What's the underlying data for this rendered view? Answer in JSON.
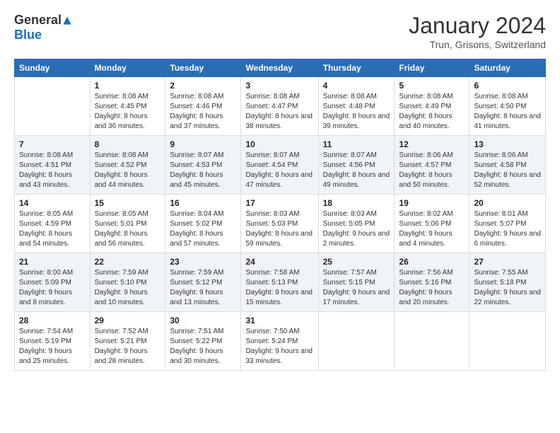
{
  "header": {
    "logo_general": "General",
    "logo_blue": "Blue",
    "month_title": "January 2024",
    "location": "Trun, Grisons, Switzerland"
  },
  "days_of_week": [
    "Sunday",
    "Monday",
    "Tuesday",
    "Wednesday",
    "Thursday",
    "Friday",
    "Saturday"
  ],
  "weeks": [
    [
      {
        "day": "",
        "sunrise": "",
        "sunset": "",
        "daylight": ""
      },
      {
        "day": "1",
        "sunrise": "Sunrise: 8:08 AM",
        "sunset": "Sunset: 4:45 PM",
        "daylight": "Daylight: 8 hours and 36 minutes."
      },
      {
        "day": "2",
        "sunrise": "Sunrise: 8:08 AM",
        "sunset": "Sunset: 4:46 PM",
        "daylight": "Daylight: 8 hours and 37 minutes."
      },
      {
        "day": "3",
        "sunrise": "Sunrise: 8:08 AM",
        "sunset": "Sunset: 4:47 PM",
        "daylight": "Daylight: 8 hours and 38 minutes."
      },
      {
        "day": "4",
        "sunrise": "Sunrise: 8:08 AM",
        "sunset": "Sunset: 4:48 PM",
        "daylight": "Daylight: 8 hours and 39 minutes."
      },
      {
        "day": "5",
        "sunrise": "Sunrise: 8:08 AM",
        "sunset": "Sunset: 4:49 PM",
        "daylight": "Daylight: 8 hours and 40 minutes."
      },
      {
        "day": "6",
        "sunrise": "Sunrise: 8:08 AM",
        "sunset": "Sunset: 4:50 PM",
        "daylight": "Daylight: 8 hours and 41 minutes."
      }
    ],
    [
      {
        "day": "7",
        "sunrise": "Sunrise: 8:08 AM",
        "sunset": "Sunset: 4:51 PM",
        "daylight": "Daylight: 8 hours and 43 minutes."
      },
      {
        "day": "8",
        "sunrise": "Sunrise: 8:08 AM",
        "sunset": "Sunset: 4:52 PM",
        "daylight": "Daylight: 8 hours and 44 minutes."
      },
      {
        "day": "9",
        "sunrise": "Sunrise: 8:07 AM",
        "sunset": "Sunset: 4:53 PM",
        "daylight": "Daylight: 8 hours and 45 minutes."
      },
      {
        "day": "10",
        "sunrise": "Sunrise: 8:07 AM",
        "sunset": "Sunset: 4:54 PM",
        "daylight": "Daylight: 8 hours and 47 minutes."
      },
      {
        "day": "11",
        "sunrise": "Sunrise: 8:07 AM",
        "sunset": "Sunset: 4:56 PM",
        "daylight": "Daylight: 8 hours and 49 minutes."
      },
      {
        "day": "12",
        "sunrise": "Sunrise: 8:06 AM",
        "sunset": "Sunset: 4:57 PM",
        "daylight": "Daylight: 8 hours and 50 minutes."
      },
      {
        "day": "13",
        "sunrise": "Sunrise: 8:06 AM",
        "sunset": "Sunset: 4:58 PM",
        "daylight": "Daylight: 8 hours and 52 minutes."
      }
    ],
    [
      {
        "day": "14",
        "sunrise": "Sunrise: 8:05 AM",
        "sunset": "Sunset: 4:59 PM",
        "daylight": "Daylight: 8 hours and 54 minutes."
      },
      {
        "day": "15",
        "sunrise": "Sunrise: 8:05 AM",
        "sunset": "Sunset: 5:01 PM",
        "daylight": "Daylight: 8 hours and 56 minutes."
      },
      {
        "day": "16",
        "sunrise": "Sunrise: 8:04 AM",
        "sunset": "Sunset: 5:02 PM",
        "daylight": "Daylight: 8 hours and 57 minutes."
      },
      {
        "day": "17",
        "sunrise": "Sunrise: 8:03 AM",
        "sunset": "Sunset: 5:03 PM",
        "daylight": "Daylight: 8 hours and 59 minutes."
      },
      {
        "day": "18",
        "sunrise": "Sunrise: 8:03 AM",
        "sunset": "Sunset: 5:05 PM",
        "daylight": "Daylight: 9 hours and 2 minutes."
      },
      {
        "day": "19",
        "sunrise": "Sunrise: 8:02 AM",
        "sunset": "Sunset: 5:06 PM",
        "daylight": "Daylight: 9 hours and 4 minutes."
      },
      {
        "day": "20",
        "sunrise": "Sunrise: 8:01 AM",
        "sunset": "Sunset: 5:07 PM",
        "daylight": "Daylight: 9 hours and 6 minutes."
      }
    ],
    [
      {
        "day": "21",
        "sunrise": "Sunrise: 8:00 AM",
        "sunset": "Sunset: 5:09 PM",
        "daylight": "Daylight: 9 hours and 8 minutes."
      },
      {
        "day": "22",
        "sunrise": "Sunrise: 7:59 AM",
        "sunset": "Sunset: 5:10 PM",
        "daylight": "Daylight: 9 hours and 10 minutes."
      },
      {
        "day": "23",
        "sunrise": "Sunrise: 7:59 AM",
        "sunset": "Sunset: 5:12 PM",
        "daylight": "Daylight: 9 hours and 13 minutes."
      },
      {
        "day": "24",
        "sunrise": "Sunrise: 7:58 AM",
        "sunset": "Sunset: 5:13 PM",
        "daylight": "Daylight: 9 hours and 15 minutes."
      },
      {
        "day": "25",
        "sunrise": "Sunrise: 7:57 AM",
        "sunset": "Sunset: 5:15 PM",
        "daylight": "Daylight: 9 hours and 17 minutes."
      },
      {
        "day": "26",
        "sunrise": "Sunrise: 7:56 AM",
        "sunset": "Sunset: 5:16 PM",
        "daylight": "Daylight: 9 hours and 20 minutes."
      },
      {
        "day": "27",
        "sunrise": "Sunrise: 7:55 AM",
        "sunset": "Sunset: 5:18 PM",
        "daylight": "Daylight: 9 hours and 22 minutes."
      }
    ],
    [
      {
        "day": "28",
        "sunrise": "Sunrise: 7:54 AM",
        "sunset": "Sunset: 5:19 PM",
        "daylight": "Daylight: 9 hours and 25 minutes."
      },
      {
        "day": "29",
        "sunrise": "Sunrise: 7:52 AM",
        "sunset": "Sunset: 5:21 PM",
        "daylight": "Daylight: 9 hours and 28 minutes."
      },
      {
        "day": "30",
        "sunrise": "Sunrise: 7:51 AM",
        "sunset": "Sunset: 5:22 PM",
        "daylight": "Daylight: 9 hours and 30 minutes."
      },
      {
        "day": "31",
        "sunrise": "Sunrise: 7:50 AM",
        "sunset": "Sunset: 5:24 PM",
        "daylight": "Daylight: 9 hours and 33 minutes."
      },
      {
        "day": "",
        "sunrise": "",
        "sunset": "",
        "daylight": ""
      },
      {
        "day": "",
        "sunrise": "",
        "sunset": "",
        "daylight": ""
      },
      {
        "day": "",
        "sunrise": "",
        "sunset": "",
        "daylight": ""
      }
    ]
  ]
}
